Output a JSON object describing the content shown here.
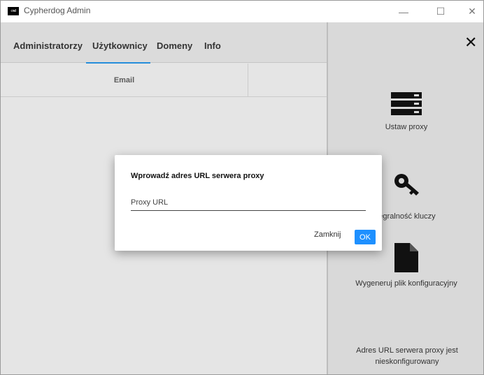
{
  "window": {
    "logo_text": "cmd",
    "title": "Cypherdog Admin",
    "minimize_glyph": "—",
    "maximize_glyph": "☐",
    "close_glyph": "✕"
  },
  "tabs": [
    {
      "label": "Administratorzy"
    },
    {
      "label": "Użytkownicy",
      "active": true
    },
    {
      "label": "Domeny"
    },
    {
      "label": "Info"
    }
  ],
  "table": {
    "columns": [
      "Email"
    ]
  },
  "drawer": {
    "close_glyph": "✕",
    "items": [
      {
        "label": "Ustaw proxy",
        "icon": "server-icon"
      },
      {
        "label": "dź integralność kluczy",
        "icon": "key-icon"
      },
      {
        "label": "Wygeneruj plik konfiguracyjny",
        "icon": "file-icon"
      }
    ],
    "status": "Adres URL serwera proxy jest nieskonfigurowany"
  },
  "dialog": {
    "title": "Wprowadź adres URL serwera proxy",
    "input_placeholder": "Proxy URL",
    "input_value": "",
    "cancel_label": "Zamknij",
    "ok_label": "OK"
  },
  "colors": {
    "accent": "#1e90ff",
    "tab_indicator": "#2a9df4",
    "drawer_bg": "#d9d9d9"
  }
}
